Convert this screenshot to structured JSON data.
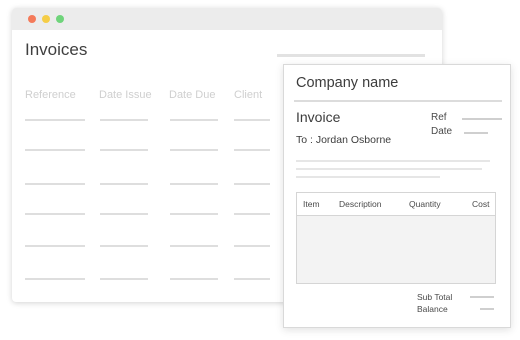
{
  "window": {
    "title": "Invoices",
    "columns": [
      "Reference",
      "Date Issue",
      "Date Due",
      "Client"
    ]
  },
  "document": {
    "company": "Company name",
    "title": "Invoice",
    "to": "To : Jordan Osborne",
    "ref_label": "Ref",
    "date_label": "Date",
    "table_columns": [
      "Item",
      "Description",
      "Quantity",
      "Cost"
    ],
    "subtotal_label": "Sub Total",
    "balance_label": "Balance"
  },
  "colors": {
    "close": "#f47a5a",
    "minimize": "#f5cd47",
    "maximize": "#6fd47b"
  }
}
